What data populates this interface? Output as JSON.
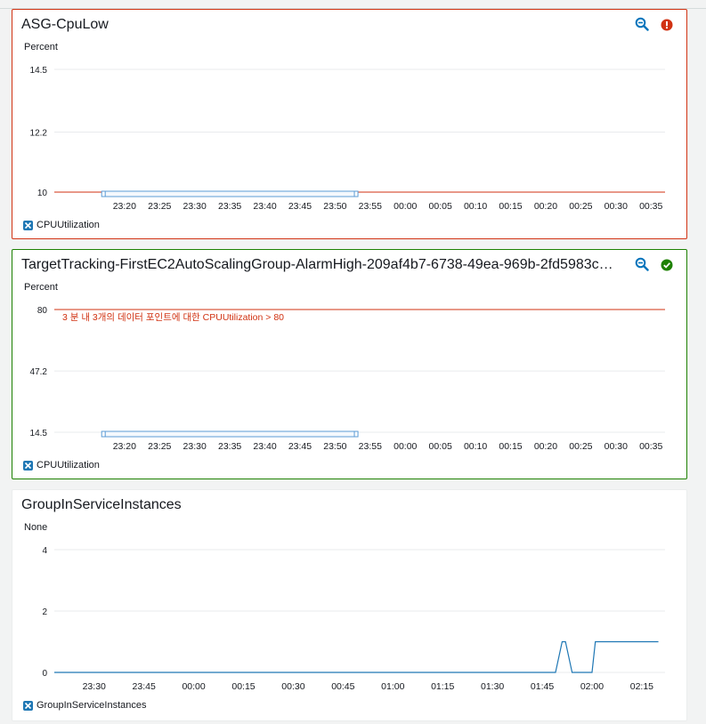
{
  "colors": {
    "series": "#1f77b4",
    "threshold": "#d13212",
    "alarm": "#d13212",
    "ok": "#1d8102",
    "zoom": "#0073bb"
  },
  "widgets": [
    {
      "title": "ASG-CpuLow",
      "state": "alarm",
      "state_icon": "exclamation-circle-icon",
      "zoom_icon": "zoom-out-icon",
      "unit": "Percent",
      "legend": "CPUUtilization"
    },
    {
      "title": "TargetTracking-FirstEC2AutoScalingGroup-AlarmHigh-209af4b7-6738-49ea-969b-2fd5983c…",
      "state": "ok",
      "state_icon": "check-circle-icon",
      "zoom_icon": "zoom-out-icon",
      "unit": "Percent",
      "legend": "CPUUtilization"
    },
    {
      "title": "GroupInServiceInstances",
      "unit": "None",
      "legend": "GroupInServiceInstances"
    }
  ],
  "chart_data": [
    {
      "type": "line",
      "yticks": [
        "14.5",
        "12.2",
        "10"
      ],
      "ylim": [
        10,
        14.5
      ],
      "x_ticks": [
        "23:20",
        "23:25",
        "23:30",
        "23:35",
        "23:40",
        "23:45",
        "23:50",
        "23:55",
        "00:00",
        "00:05",
        "00:10",
        "00:15",
        "00:20",
        "00:25",
        "00:30",
        "00:35"
      ],
      "threshold": 10,
      "threshold_label": "",
      "series": [
        {
          "x": [
            "23:17",
            "23:53"
          ],
          "y": [
            null,
            null
          ]
        }
      ],
      "grid": true
    },
    {
      "type": "line",
      "yticks": [
        "80",
        "47.2",
        "14.5"
      ],
      "ylim": [
        14.5,
        80
      ],
      "x_ticks": [
        "23:20",
        "23:25",
        "23:30",
        "23:35",
        "23:40",
        "23:45",
        "23:50",
        "23:55",
        "00:00",
        "00:05",
        "00:10",
        "00:15",
        "00:20",
        "00:25",
        "00:30",
        "00:35"
      ],
      "threshold": 80,
      "threshold_label": "3 분 내 3개의 데이터 포인트에 대한 CPUUtilization > 80",
      "series": [
        {
          "x": [
            "23:17",
            "23:53"
          ],
          "y": [
            null,
            null
          ]
        }
      ],
      "grid": true
    },
    {
      "type": "line",
      "yticks": [
        "4",
        "2",
        "0"
      ],
      "ylim": [
        0,
        4
      ],
      "x_ticks": [
        "23:30",
        "23:45",
        "00:00",
        "00:15",
        "00:30",
        "00:45",
        "01:00",
        "01:15",
        "01:30",
        "01:45",
        "02:00",
        "02:15"
      ],
      "grid": true,
      "series": [
        {
          "name": "GroupInServiceInstances",
          "x": [
            "23:18",
            "01:49",
            "01:51",
            "01:52",
            "01:54",
            "01:55",
            "02:00",
            "02:01",
            "02:20"
          ],
          "y": [
            0,
            0,
            1,
            1,
            0,
            0,
            0,
            1,
            1
          ]
        }
      ]
    }
  ]
}
